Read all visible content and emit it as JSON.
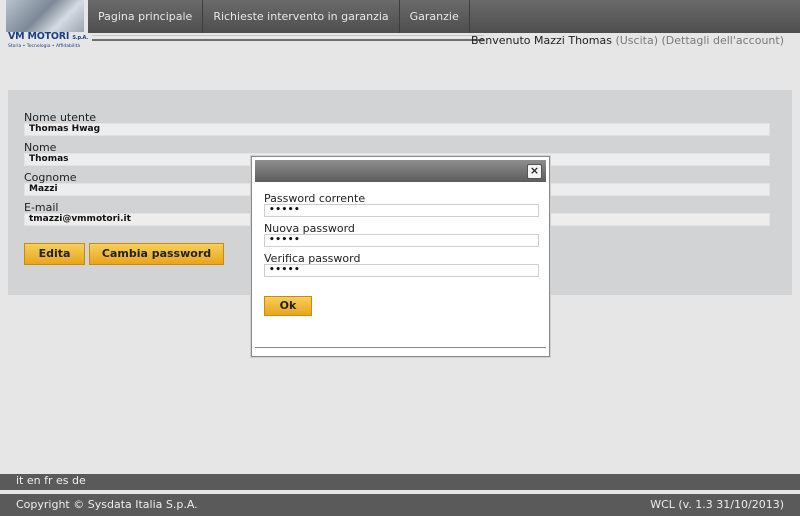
{
  "logo": {
    "brand": "VM MOTORI",
    "brand_suffix": "S.p.A.",
    "tagline": "Storia • Tecnologia • Affidabilità"
  },
  "nav": {
    "items": [
      {
        "label": "Pagina principale"
      },
      {
        "label": "Richieste intervento in garanzia"
      },
      {
        "label": "Garanzie"
      }
    ]
  },
  "header": {
    "welcome_text": "Benvenuto Mazzi Thomas",
    "logout_link": "(Uscita)",
    "account_link": "(Dettagli dell'account)"
  },
  "profile": {
    "username_label": "Nome utente",
    "username_value": "Thomas Hwag",
    "name_label": "Nome",
    "name_value": "Thomas",
    "surname_label": "Cognome",
    "surname_value": "Mazzi",
    "email_label": "E-mail",
    "email_value": "tmazzi@vmmotori.it",
    "edit_button": "Edita",
    "change_password_button": "Cambia password"
  },
  "modal": {
    "current_password_label": "Password corrente",
    "current_password_value": "•••••",
    "new_password_label": "Nuova password",
    "new_password_value": "•••••",
    "verify_password_label": "Verifica password",
    "verify_password_value": "•••••",
    "ok_button": "Ok",
    "close_glyph": "×"
  },
  "languages": [
    "it",
    "en",
    "fr",
    "es",
    "de"
  ],
  "footer": {
    "copyright": "Copyright © Sysdata Italia S.p.A.",
    "version": "WCL (v. 1.3 31/10/2013)"
  },
  "colors": {
    "accent_button": "#e9a51c",
    "nav_background": "#5a5a5a",
    "brand_blue": "#1b3e86"
  }
}
